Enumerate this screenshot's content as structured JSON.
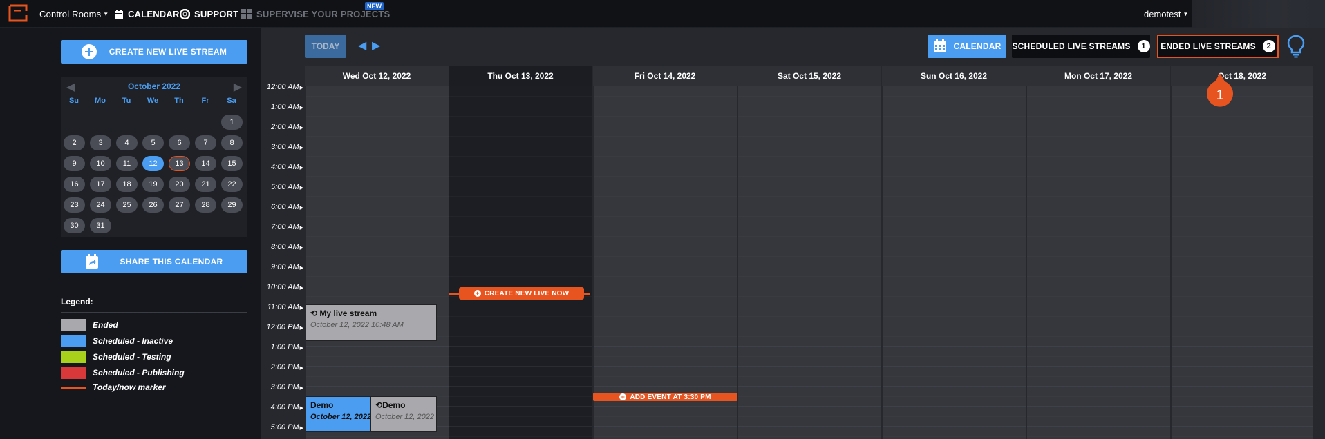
{
  "topbar": {
    "control_rooms": "Control Rooms",
    "calendar": "CALENDAR",
    "support": "SUPPORT",
    "supervise": "SUPERVISE YOUR PROJECTS",
    "new_badge": "NEW",
    "user": "demotest"
  },
  "sidebar": {
    "create_button": "CREATE NEW LIVE STREAM",
    "share_button": "SHARE THIS CALENDAR",
    "mini_calendar": {
      "month": "October 2022",
      "days_of_week": [
        "Su",
        "Mo",
        "Tu",
        "We",
        "Th",
        "Fr",
        "Sa"
      ],
      "days": [
        "1",
        "2",
        "3",
        "4",
        "5",
        "6",
        "7",
        "8",
        "9",
        "10",
        "11",
        "12",
        "13",
        "14",
        "15",
        "16",
        "17",
        "18",
        "19",
        "20",
        "21",
        "22",
        "23",
        "24",
        "25",
        "26",
        "27",
        "28",
        "29",
        "30",
        "31"
      ],
      "selected_day": "12",
      "today_day": "13"
    },
    "legend": {
      "title": "Legend:",
      "items": [
        {
          "label": "Ended",
          "color": "#a9a9ad"
        },
        {
          "label": "Scheduled - Inactive",
          "color": "#4a9df0"
        },
        {
          "label": "Scheduled - Testing",
          "color": "#a8d11b"
        },
        {
          "label": "Scheduled - Publishing",
          "color": "#d9383a"
        },
        {
          "label": "Today/now marker",
          "color": "#e8541f"
        }
      ]
    }
  },
  "toolbar": {
    "today": "TODAY",
    "calendar": "CALENDAR",
    "scheduled": "SCHEDULED LIVE STREAMS",
    "scheduled_count": "1",
    "ended": "ENDED LIVE STREAMS",
    "ended_count": "2",
    "marker_number": "1"
  },
  "calendar": {
    "columns": [
      "Wed Oct 12, 2022",
      "Thu Oct 13, 2022",
      "Fri Oct 14, 2022",
      "Sat Oct 15, 2022",
      "Sun Oct 16, 2022",
      "Mon Oct 17, 2022",
      "Oct 18, 2022"
    ],
    "hours": [
      "12:00 AM",
      "1:00 AM",
      "2:00 AM",
      "3:00 AM",
      "4:00 AM",
      "5:00 AM",
      "6:00 AM",
      "7:00 AM",
      "8:00 AM",
      "9:00 AM",
      "10:00 AM",
      "11:00 AM",
      "12:00 PM",
      "1:00 PM",
      "2:00 PM",
      "3:00 PM",
      "4:00 PM",
      "5:00 PM"
    ],
    "create_now": "CREATE NEW LIVE NOW",
    "add_event": "ADD EVENT AT 3:30 PM",
    "events": {
      "my_live": {
        "title": "My live stream",
        "date": "October 12, 2022 10:48 AM"
      },
      "demo_blue": {
        "title": "Demo",
        "date": "October 12, 2022"
      },
      "demo_grey": {
        "title": "Demo",
        "date": "October 12, 2022"
      }
    }
  },
  "colors": {
    "accent": "#4a9df0",
    "orange": "#e8541f"
  }
}
